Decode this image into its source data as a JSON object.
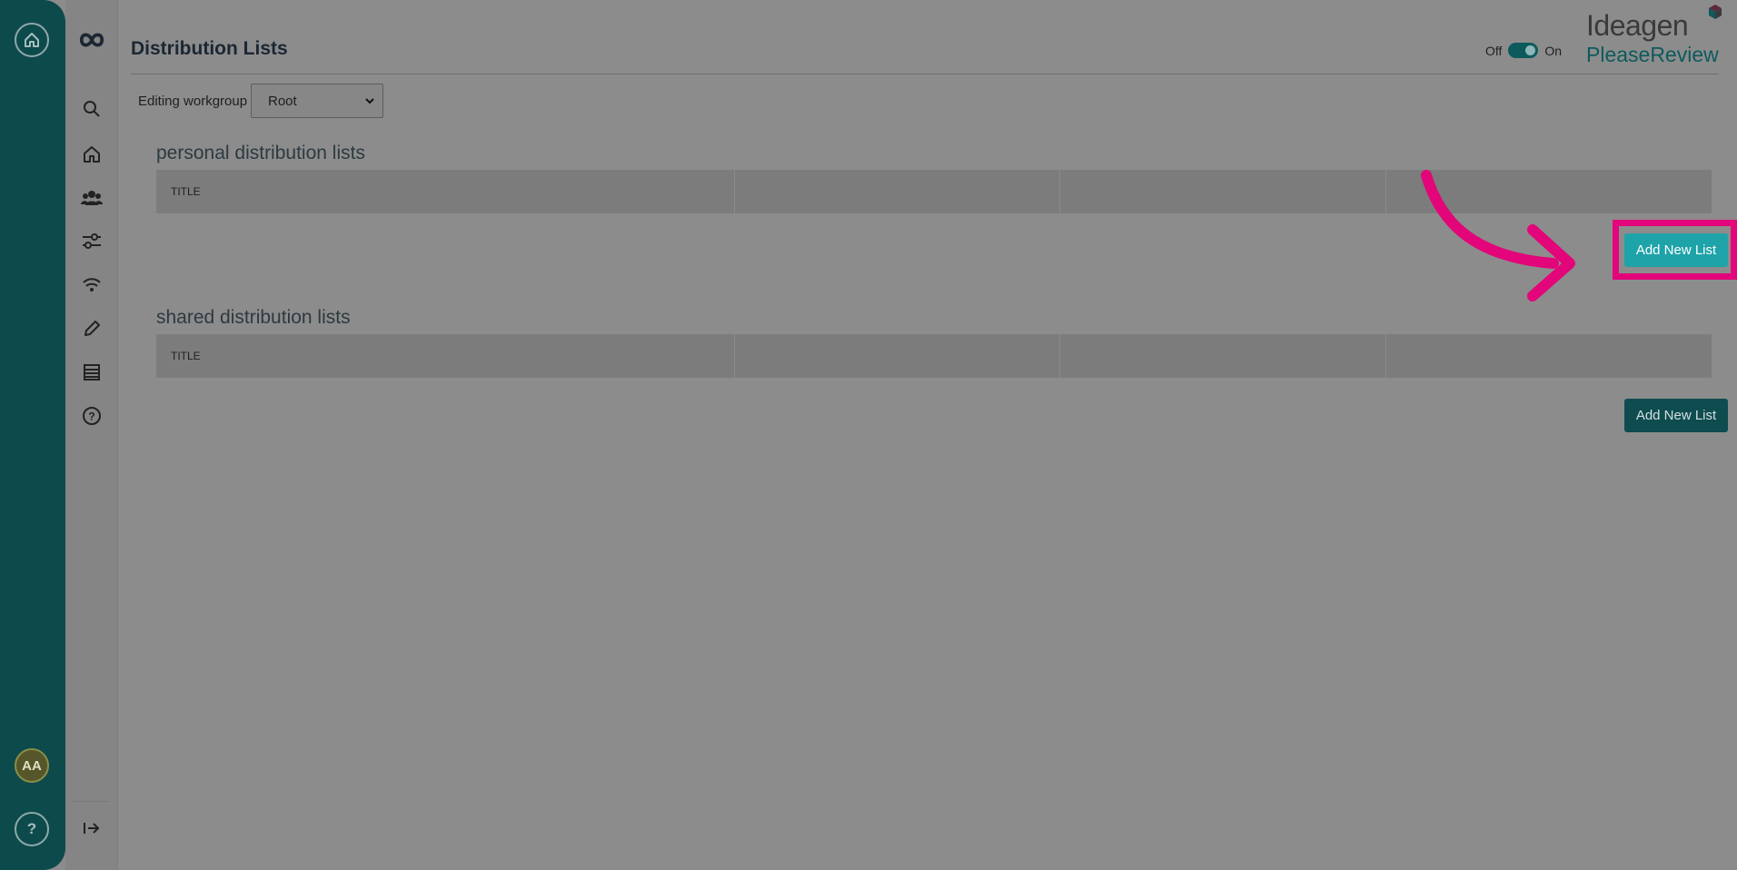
{
  "rail": {
    "home_icon": "house-circle-icon",
    "avatar_initials": "AA",
    "help_label": "?"
  },
  "sidebar": {
    "icons": [
      "logo-icon",
      "search-icon",
      "home-icon",
      "users-icon",
      "sliders-icon",
      "wifi-icon",
      "pencil-icon",
      "list-icon",
      "help-circle-icon"
    ],
    "collapse_icon": "expand-right-icon"
  },
  "header": {
    "title": "Distribution Lists",
    "toggle_off": "Off",
    "toggle_on": "On",
    "brand_top": "Ideagen",
    "brand_bottom": "PleaseReview"
  },
  "workgroup": {
    "label": "Editing workgroup",
    "selected": "Root"
  },
  "personal": {
    "title": "personal distribution lists",
    "columns": [
      "TITLE",
      "",
      "",
      ""
    ],
    "add_button": "Add New List"
  },
  "shared": {
    "title": "shared distribution lists",
    "columns": [
      "TITLE",
      "",
      "",
      ""
    ],
    "add_button": "Add New List"
  },
  "colors": {
    "accent": "#1ea3a9",
    "rail": "#0d4a4c",
    "highlight": "#e3057a"
  }
}
